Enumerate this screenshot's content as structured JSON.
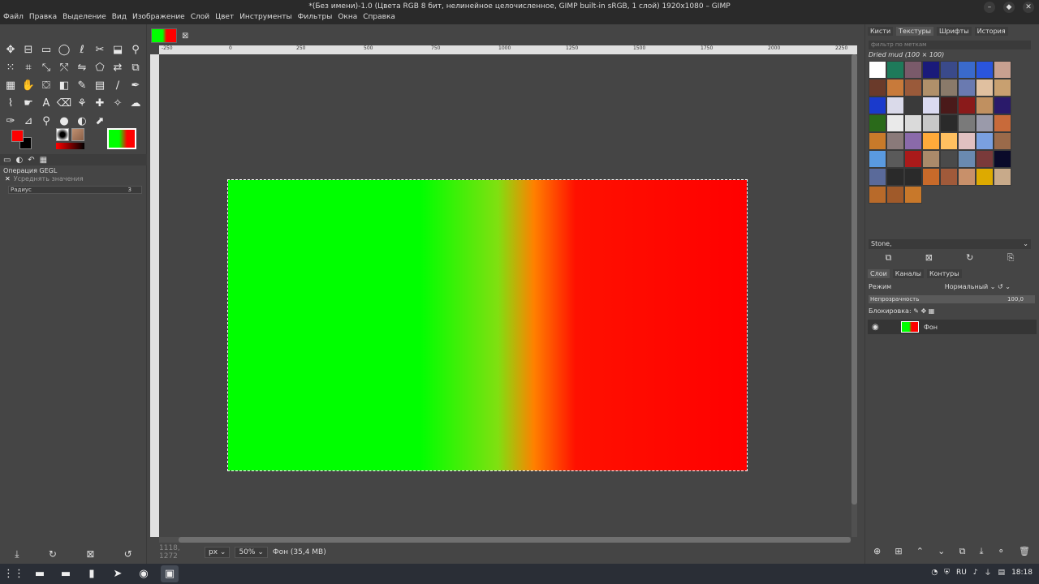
{
  "window": {
    "title": "*(Без имени)-1.0 (Цвета RGB 8 бит, нелинейное целочисленное, GIMP built-in sRGB, 1 слой) 1920x1080 – GIMP"
  },
  "menu": [
    "Файл",
    "Правка",
    "Выделение",
    "Вид",
    "Изображение",
    "Слой",
    "Цвет",
    "Инструменты",
    "Фильтры",
    "Окна",
    "Справка"
  ],
  "toolbox": {
    "tools": [
      {
        "name": "move-tool-icon",
        "glyph": "✥"
      },
      {
        "name": "align-tool-icon",
        "glyph": "⊟"
      },
      {
        "name": "rect-select-icon",
        "glyph": "▭"
      },
      {
        "name": "ellipse-select-icon",
        "glyph": "◯"
      },
      {
        "name": "lasso-icon",
        "glyph": "ℓ"
      },
      {
        "name": "scissors-icon",
        "glyph": "✂"
      },
      {
        "name": "foreground-select-icon",
        "glyph": "⬓"
      },
      {
        "name": "fuzzy-select-icon",
        "glyph": "⚲"
      },
      {
        "name": "color-select-icon",
        "glyph": "⁙"
      },
      {
        "name": "crop-icon",
        "glyph": "⌗"
      },
      {
        "name": "unified-transform-icon",
        "glyph": "⤡"
      },
      {
        "name": "warp-icon",
        "glyph": "⤲"
      },
      {
        "name": "flip-icon",
        "glyph": "⇋"
      },
      {
        "name": "cage-icon",
        "glyph": "⬠"
      },
      {
        "name": "handle-transform-icon",
        "glyph": "⇄"
      },
      {
        "name": "perspective-clone-icon",
        "glyph": "⧉"
      },
      {
        "name": "perspective-icon",
        "glyph": "▦"
      },
      {
        "name": "smudge-icon",
        "glyph": "✋"
      },
      {
        "name": "paint-bucket-icon",
        "glyph": "⛋"
      },
      {
        "name": "gradient-icon",
        "glyph": "◧"
      },
      {
        "name": "pencil-icon",
        "glyph": "✎"
      },
      {
        "name": "blend-icon",
        "glyph": "▤"
      },
      {
        "name": "airbrush-icon",
        "glyph": "∕"
      },
      {
        "name": "ink-icon",
        "glyph": "✒"
      },
      {
        "name": "paintbrush-icon",
        "glyph": "⌇"
      },
      {
        "name": "mypaint-brush-icon",
        "glyph": "☛"
      },
      {
        "name": "text-tool-icon",
        "glyph": "A"
      },
      {
        "name": "eraser-icon",
        "glyph": "⌫"
      },
      {
        "name": "clone-icon",
        "glyph": "⚘"
      },
      {
        "name": "heal-icon",
        "glyph": "✚"
      },
      {
        "name": "dodge-burn-icon",
        "glyph": "✧"
      },
      {
        "name": "speech-bubble-icon",
        "glyph": "☁"
      },
      {
        "name": "color-picker-icon",
        "glyph": "✑"
      },
      {
        "name": "measure-icon",
        "glyph": "⊿"
      },
      {
        "name": "zoom-icon",
        "glyph": "⚲"
      },
      {
        "name": "drop-icon",
        "glyph": "●"
      },
      {
        "name": "filter-icon",
        "glyph": "◐"
      },
      {
        "name": "paths-icon",
        "glyph": "⬈"
      }
    ],
    "tabs": [
      "▭",
      "◐",
      "↶",
      "▦"
    ],
    "options_title": "Операция GEGL",
    "options_check_label": "Усреднять значения",
    "radius_label": "Радиус",
    "radius_value": "3",
    "bottom_icons": [
      "⤓",
      "↻",
      "⊠",
      "↺"
    ]
  },
  "canvas": {
    "ruler_ticks": [
      "-250",
      "0",
      "250",
      "500",
      "750",
      "1000",
      "1250",
      "1500",
      "1750",
      "2000",
      "2250"
    ],
    "coords": "1118, 1272",
    "unit": "px",
    "zoom": "50%",
    "layer_info": "Фон (35,4 MB)",
    "gradient_colors": {
      "left": "#00ff00",
      "right": "#ff0000"
    }
  },
  "right_dock": {
    "tabs": [
      "Кисти",
      "Текстуры",
      "Шрифты",
      "История"
    ],
    "filter_placeholder": "фильтр по меткам",
    "pattern_name": "Dried mud (100 × 100)",
    "tag_label": "Stone,",
    "layer_tabs": [
      "Слои",
      "Каналы",
      "Контуры"
    ],
    "mode_label": "Режим",
    "mode_value": "Нормальный",
    "opacity_label": "Непрозрачность",
    "opacity_value": "100,0",
    "lock_label": "Блокировка:",
    "layer_name": "Фон",
    "bottom_icons": [
      "⊕",
      "⊞",
      "⌃",
      "⌄",
      "⧉",
      "⤓",
      "⚬",
      "🗑"
    ],
    "pattern_colors": [
      "#ffffff",
      "#1e7a5a",
      "#7a5a6a",
      "#1a1a7a",
      "#3a4a8a",
      "#3a6acc",
      "#2a55dd",
      "#c8a090",
      "#6a3a2a",
      "#c87a3a",
      "#9a5a3a",
      "#b0906a",
      "#8a7a6a",
      "#6a7ab0",
      "#e0c0a0",
      "#c8a070",
      "#1a3acc",
      "#dadaea",
      "#3a3a3a",
      "#dadaf0",
      "#4a1a1a",
      "#8a1a1a",
      "#c09060",
      "#2a1a6a",
      "#2a6a1a",
      "#eaeaea",
      "#dadada",
      "#c8c8c8",
      "#2a2a2a",
      "#7a7a7a",
      "#9a9aaa",
      "#c86a3a",
      "#c87a2a",
      "#8a7a7a",
      "#8a6aaa",
      "#ffaa3a",
      "#ffc060",
      "#e0c0c0",
      "#7aa0e0",
      "#9a6a4a",
      "#5a9ae0",
      "#5a5a5a",
      "#aa1a1a",
      "#aa8a6a",
      "#4a4a4a",
      "#6a8ab0",
      "#7a3a3a",
      "#0a0a2a",
      "#5a6a9a",
      "#2a2a2a",
      "#2a2a2a",
      "#c86a2a",
      "#a05a3a",
      "#c8906a",
      "#ddaa00",
      "#c8aa8a",
      "#b86a2a",
      "#a05a2a",
      "#c8782a"
    ]
  },
  "taskbar": {
    "lang": "RU",
    "time": "18:18",
    "apps": [
      "⋮⋮",
      "▬",
      "▬",
      "▮",
      "➤",
      "◉",
      "▣"
    ]
  }
}
